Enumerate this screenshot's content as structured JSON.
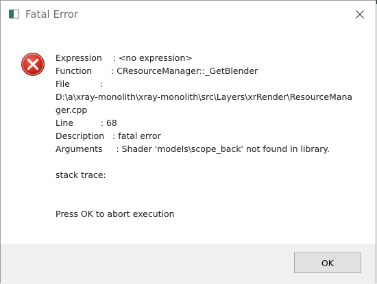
{
  "window": {
    "title": "Fatal Error",
    "close_icon": "close-icon",
    "app_icon": "window-app-icon"
  },
  "message": {
    "icon": "error-icon",
    "expression": "Expression    : <no expression>",
    "function": "Function       : CResourceManager::_GetBlender",
    "file_label": "File           :",
    "file_path": "D:\\a\\xray-monolith\\xray-monolith\\src\\Layers\\xrRender\\ResourceManager.cpp",
    "line": "Line          : 68",
    "description": "Description   : fatal error",
    "arguments": "Arguments     : Shader 'models\\scope_back' not found in library.",
    "stack_trace": "stack trace:",
    "prompt": "Press OK to abort execution"
  },
  "buttons": {
    "ok_label": "OK"
  },
  "colors": {
    "error_red": "#c42b1c",
    "button_bg": "#e1e1e1",
    "footer_bg": "#f0f0f0"
  }
}
